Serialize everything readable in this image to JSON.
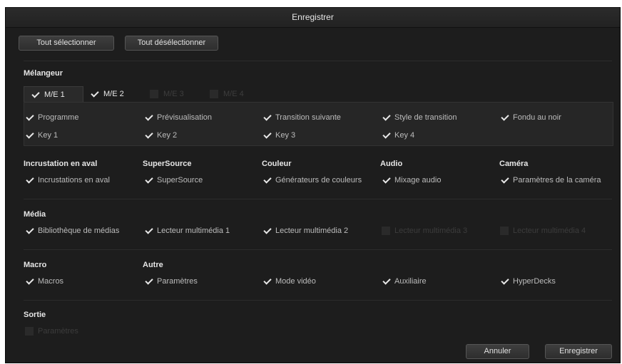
{
  "window": {
    "title": "Enregistrer"
  },
  "top_buttons": {
    "select_all": "Tout sélectionner",
    "deselect_all": "Tout désélectionner"
  },
  "melangeur": {
    "title": "Mélangeur",
    "tabs": [
      {
        "label": "M/E 1",
        "checked": true
      },
      {
        "label": "M/E 2",
        "checked": true
      },
      {
        "label": "M/E 3",
        "checked": false
      },
      {
        "label": "M/E 4",
        "checked": false
      }
    ],
    "items": [
      {
        "label": "Programme",
        "checked": true
      },
      {
        "label": "Prévisualisation",
        "checked": true
      },
      {
        "label": "Transition suivante",
        "checked": true
      },
      {
        "label": "Style de transition",
        "checked": true
      },
      {
        "label": "Fondu au noir",
        "checked": true
      },
      {
        "label": "Key 1",
        "checked": true
      },
      {
        "label": "Key 2",
        "checked": true
      },
      {
        "label": "Key 3",
        "checked": true
      },
      {
        "label": "Key 4",
        "checked": true
      }
    ]
  },
  "row2": [
    {
      "title": "Incrustation en aval",
      "item": "Incrustations en aval",
      "checked": true
    },
    {
      "title": "SuperSource",
      "item": "SuperSource",
      "checked": true
    },
    {
      "title": "Couleur",
      "item": "Générateurs de couleurs",
      "checked": true
    },
    {
      "title": "Audio",
      "item": "Mixage audio",
      "checked": true
    },
    {
      "title": "Caméra",
      "item": "Paramètres de la caméra",
      "checked": true
    }
  ],
  "media": {
    "title": "Média",
    "items": [
      {
        "label": "Bibliothèque de médias",
        "checked": true
      },
      {
        "label": "Lecteur multimédia 1",
        "checked": true
      },
      {
        "label": "Lecteur multimédia 2",
        "checked": true
      },
      {
        "label": "Lecteur multimédia 3",
        "checked": false
      },
      {
        "label": "Lecteur multimédia 4",
        "checked": false
      }
    ]
  },
  "macro": {
    "title": "Macro",
    "item": "Macros",
    "checked": true
  },
  "autre": {
    "title": "Autre",
    "items": [
      {
        "label": "Paramètres",
        "checked": true
      },
      {
        "label": "Mode vidéo",
        "checked": true
      },
      {
        "label": "Auxiliaire",
        "checked": true
      },
      {
        "label": "HyperDecks",
        "checked": true
      }
    ]
  },
  "sortie": {
    "title": "Sortie",
    "item": "Paramètres",
    "checked": false
  },
  "footer": {
    "cancel": "Annuler",
    "save": "Enregistrer"
  }
}
